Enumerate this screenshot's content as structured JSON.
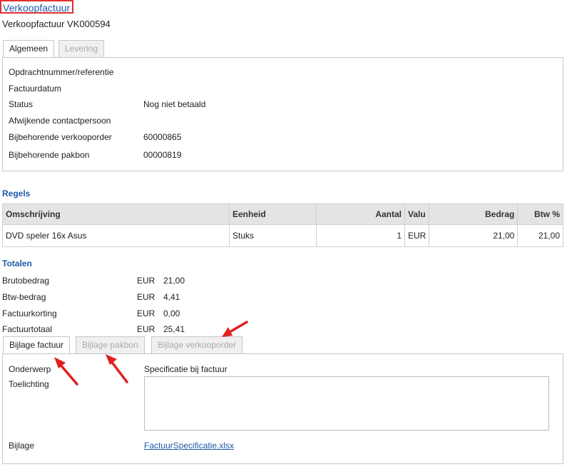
{
  "header": {
    "title": "Verkoopfactuur",
    "subtitle": "Verkoopfactuur VK000594"
  },
  "tabs_top": [
    {
      "label": "Algemeen",
      "active": true
    },
    {
      "label": "Levering",
      "active": false
    }
  ],
  "general": {
    "fields": [
      {
        "label": "Opdrachtnummer/referentie",
        "value": ""
      },
      {
        "label": "Factuurdatum",
        "value": ""
      },
      {
        "label": "Status",
        "value": "Nog niet betaald"
      },
      {
        "label": "Afwijkende contactpersoon",
        "value": ""
      },
      {
        "label": "Bijbehorende verkooporder",
        "value": "60000865"
      },
      {
        "label": "Bijbehorende pakbon",
        "value": "00000819"
      }
    ]
  },
  "lines": {
    "heading": "Regels",
    "columns": [
      "Omschrijving",
      "Eenheid",
      "Aantal",
      "Valu",
      "Bedrag",
      "Btw %"
    ],
    "rows": [
      [
        "DVD speler 16x Asus",
        "Stuks",
        "1",
        "EUR",
        "21,00",
        "21,00"
      ]
    ]
  },
  "totals": {
    "heading": "Totalen",
    "items": [
      {
        "label": "Brutobedrag",
        "currency": "EUR",
        "value": "21,00"
      },
      {
        "label": "Btw-bedrag",
        "currency": "EUR",
        "value": "4,41"
      },
      {
        "label": "Factuurkorting",
        "currency": "EUR",
        "value": "0,00"
      },
      {
        "label": "Factuurtotaal",
        "currency": "EUR",
        "value": "25,41"
      }
    ]
  },
  "tabs_bottom": [
    {
      "label": "Bijlage factuur",
      "active": true
    },
    {
      "label": "Bijlage pakbon",
      "active": false
    },
    {
      "label": "Bijlage verkooporder",
      "active": false
    }
  ],
  "attachment": {
    "subject_label": "Onderwerp",
    "subject_value": "Specificatie bij factuur",
    "note_label": "Toelichting",
    "note_value": "",
    "file_label": "Bijlage",
    "file_value": "FactuurSpecificatie.xlsx"
  },
  "colors": {
    "accent": "#1d5aa8",
    "annotation": "#e02020"
  }
}
